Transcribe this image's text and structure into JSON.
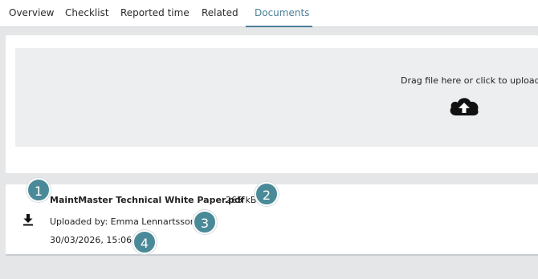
{
  "tabs": [
    {
      "label": "Overview",
      "active": false
    },
    {
      "label": "Checklist",
      "active": false
    },
    {
      "label": "Reported time",
      "active": false
    },
    {
      "label": "Related",
      "active": false
    },
    {
      "label": "Documents",
      "active": true
    }
  ],
  "upload": {
    "prompt": "Drag file here or click to upload",
    "icon": "cloud-upload-icon"
  },
  "document": {
    "name": "MaintMaster Technical White Paper.pdf",
    "size": "265 kB",
    "uploaded_by": "Uploaded by: Emma Lennartsson",
    "uploaded_at": "30/03/2026, 15:06",
    "action_icon": "download-icon"
  },
  "callouts": [
    "1",
    "2",
    "3",
    "4"
  ],
  "colors": {
    "accent": "#4a7f96",
    "callout": "#4a8a98",
    "page_background": "#e4e6e8",
    "dropzone": "#eceef0"
  }
}
